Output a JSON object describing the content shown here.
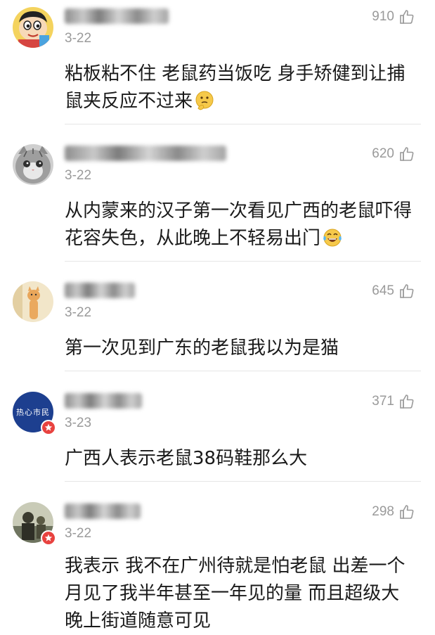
{
  "comments": [
    {
      "username": "",
      "date": "3-22",
      "likes": "910",
      "text": "粘板粘不住 老鼠药当饭吃 身手矫健到让捕鼠夹反应不过来",
      "emoji": "thinking-emoji",
      "avatar": "cartoon-boy-avatar",
      "badge": false
    },
    {
      "username": "",
      "date": "3-22",
      "likes": "620",
      "text": "从内蒙来的汉子第一次看见广西的老鼠吓得花容失色，从此晚上不轻易出门",
      "emoji": "tears-of-joy-emoji",
      "avatar": "kitten-avatar",
      "badge": false
    },
    {
      "username": "",
      "date": "3-22",
      "likes": "645",
      "text": "第一次见到广东的老鼠我以为是猫",
      "emoji": "",
      "avatar": "cat-photo-avatar",
      "badge": false
    },
    {
      "username": "",
      "date": "3-23",
      "likes": "371",
      "text": "广西人表示老鼠38码鞋那么大",
      "emoji": "",
      "avatar": "热心市民",
      "badge": true
    },
    {
      "username": "",
      "date": "3-22",
      "likes": "298",
      "text": "我表示 我不在广州待就是怕老鼠  出差一个月见了我半年甚至一年见的量 而且超级大 晚上街道随意可见",
      "emoji": "",
      "avatar": "person-photo-avatar",
      "badge": true
    }
  ],
  "colors": {
    "meta": "#9a9a9a",
    "text": "#1a1a1a",
    "badge": "#e8423f",
    "divider": "#e6e6e6"
  }
}
